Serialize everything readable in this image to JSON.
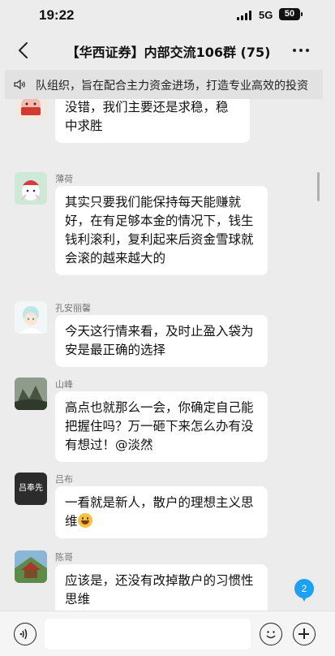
{
  "status": {
    "time": "19:22",
    "network": "5G",
    "battery": "50"
  },
  "header": {
    "title": "【华西证券】内部交流106群 (75)",
    "back_icon": "chevron-left-icon",
    "more_icon": "more-dots-icon"
  },
  "notice": {
    "icon": "speaker-icon",
    "text": "队组织，旨在配合主力资金进场，打造专业高效的投资"
  },
  "messages": [
    {
      "sender": "",
      "text": "没错，我们主要还是求稳，稳中求胜"
    },
    {
      "sender": "薄荷",
      "text": "其实只要我们能保持每天能赚就好，在有足够本金的情况下，钱生钱利滚利，复利起来后资金雪球就会滚的越来越大的"
    },
    {
      "sender": "孔安丽馨",
      "text": "今天这行情来看，及时止盈入袋为安是最正确的选择"
    },
    {
      "sender": "山峰",
      "text": "高点也就那么一会，你确定自己能把握住吗？万一砸下来怎么办有没有想过！@淡然"
    },
    {
      "sender": "吕布",
      "text": "一看就是新人，散户的理想主义思维",
      "avatar_text": "吕奉先"
    },
    {
      "sender": "陈哥",
      "text": "应该是，还没有改掉散户的习惯性思维"
    }
  ],
  "unread_count": "2",
  "input_bar": {
    "voice_icon": "voice-icon",
    "emoji_icon": "smiley-icon",
    "plus_icon": "plus-icon"
  },
  "colors": {
    "background": "#ececec",
    "bubble": "#ffffff",
    "badge": "#1da1f2"
  }
}
